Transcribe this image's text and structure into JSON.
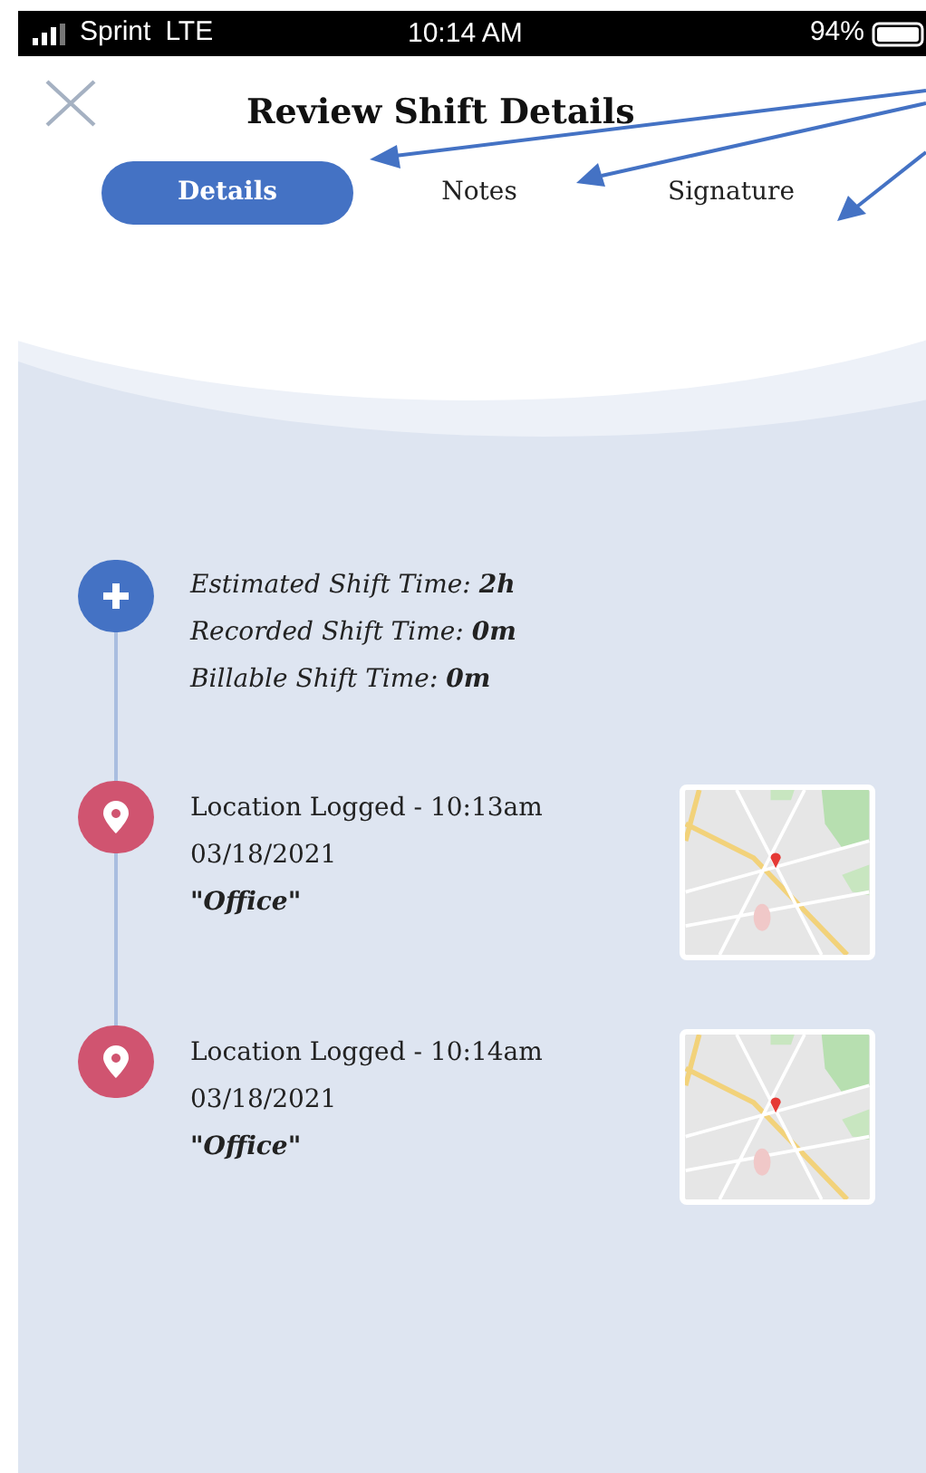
{
  "status_bar": {
    "carrier": "Sprint",
    "network": "LTE",
    "time": "10:14 AM",
    "battery": "94%"
  },
  "header": {
    "title": "Review Shift Details"
  },
  "tabs": [
    {
      "label": "Details",
      "selected": true
    },
    {
      "label": "Notes",
      "selected": false
    },
    {
      "label": "Signature",
      "selected": false
    }
  ],
  "timeline": [
    {
      "kind": "summary",
      "lines": [
        "Estimated Shift Time: **2h**",
        "Recorded Shift Time: **0m**",
        "Billable Shift Time: **0m**"
      ]
    },
    {
      "kind": "location",
      "title": "Location Logged - 10:13am",
      "date": "03/18/2021",
      "place": "\"Office\""
    },
    {
      "kind": "location",
      "title": "Location Logged - 10:14am",
      "date": "03/18/2021",
      "place": "\"Office\""
    }
  ]
}
